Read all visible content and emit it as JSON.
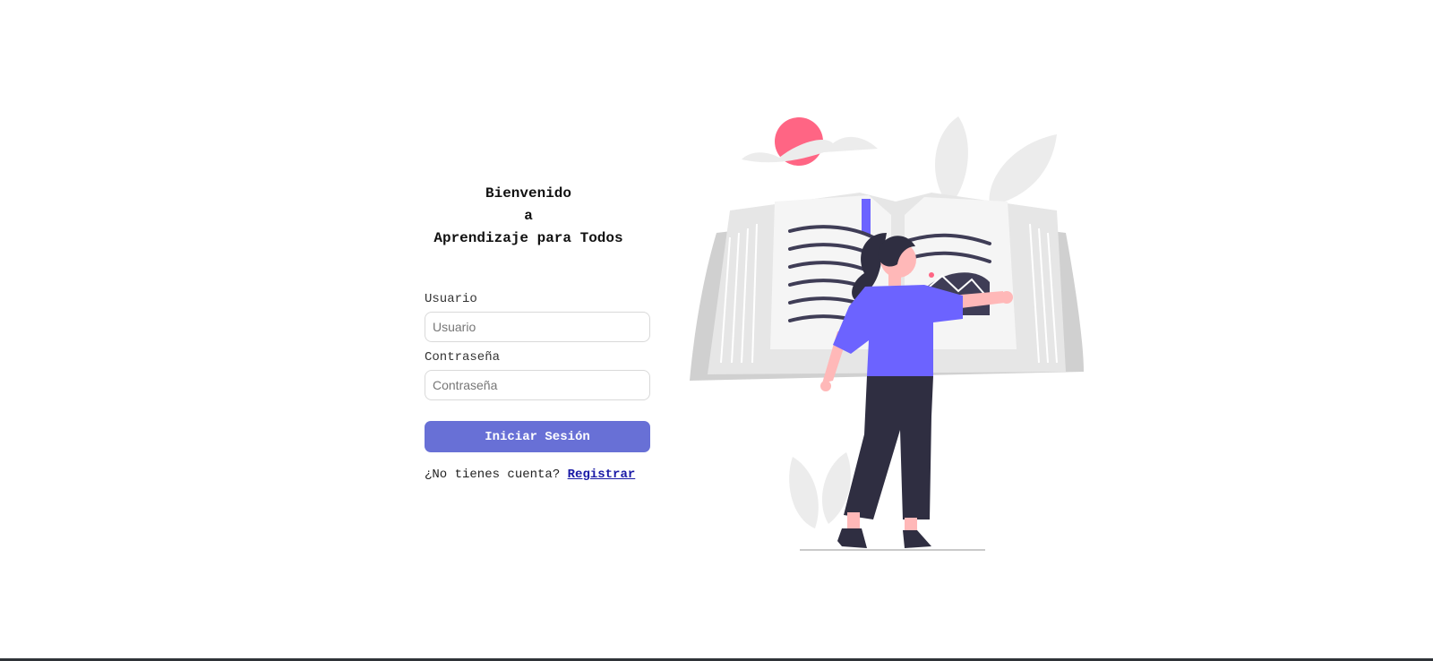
{
  "welcome": {
    "line1": "Bienvenido",
    "line2": "a",
    "line3": "Aprendizaje para Todos"
  },
  "form": {
    "username": {
      "label": "Usuario",
      "placeholder": "Usuario",
      "value": ""
    },
    "password": {
      "label": "Contraseña",
      "placeholder": "Contraseña",
      "value": ""
    },
    "submit_label": "Iniciar Sesión"
  },
  "register": {
    "prompt": "¿No tienes cuenta?",
    "link_label": "Registrar"
  },
  "colors": {
    "accent": "#6870d6",
    "link": "#1a1aa6",
    "illustration_purple": "#6c63ff",
    "illustration_pink": "#ff6584",
    "illustration_dark": "#2f2e41"
  },
  "illustration": {
    "icon": "woman-reading-book-illustration"
  }
}
